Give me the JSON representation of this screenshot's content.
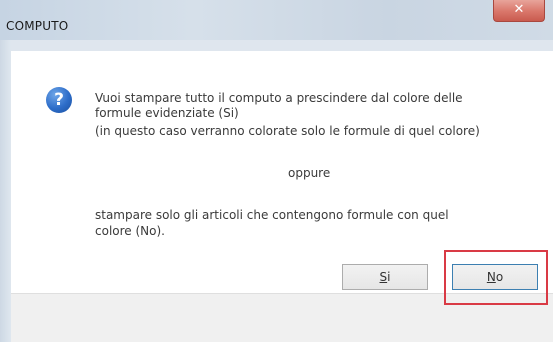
{
  "window": {
    "title": "COMPUTO",
    "close_glyph": "✕"
  },
  "icon": {
    "name": "question-icon",
    "glyph": "?",
    "color": "#2d6dc9"
  },
  "message": {
    "line1": "Vuoi stampare tutto il computo a prescindere dal colore delle",
    "line2": "formule evidenziate (Si)",
    "line3": "(in questo caso verranno colorate solo le formule di quel colore)",
    "separator": "oppure",
    "line4": "stampare solo gli articoli che contengono formule con quel",
    "line5": "colore (No)."
  },
  "buttons": {
    "yes": {
      "mnemonic": "S",
      "rest": "i"
    },
    "no": {
      "mnemonic": "N",
      "rest": "o"
    }
  },
  "highlight_color": "#d93a45"
}
